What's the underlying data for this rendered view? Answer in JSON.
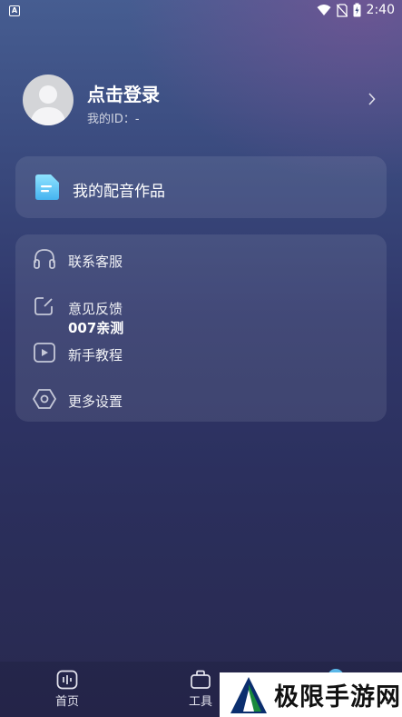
{
  "status_bar": {
    "time": "2:40",
    "app_icon": "A"
  },
  "profile": {
    "title": "点击登录",
    "user_id": "我的ID：-"
  },
  "works_card": {
    "label": "我的配音作品"
  },
  "menu": [
    {
      "label": "联系客服",
      "icon": "headset-icon"
    },
    {
      "label": "意见反馈",
      "icon": "edit-icon"
    },
    {
      "label": "新手教程",
      "icon": "play-icon"
    },
    {
      "label": "更多设置",
      "icon": "hexagon-settings-icon"
    }
  ],
  "overlay_text": "007亲测",
  "tab_bar": [
    {
      "label": "首页",
      "icon": "home-waveform-icon"
    },
    {
      "label": "工具",
      "icon": "toolbox-icon"
    }
  ],
  "watermark": {
    "text": "极限手游网"
  },
  "colors": {
    "accent": "#5ab7e8",
    "card_bg": "rgba(255,255,255,0.09)"
  }
}
